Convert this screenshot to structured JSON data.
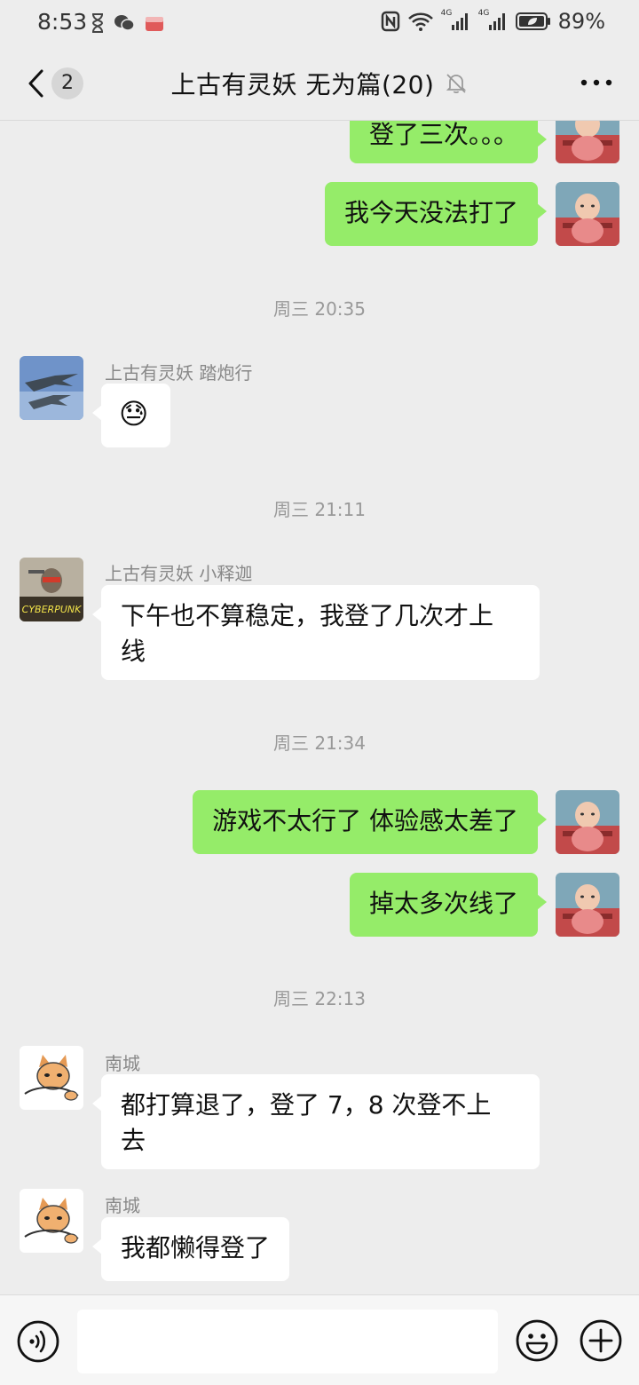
{
  "status_bar": {
    "time": "8:53",
    "battery": "89%",
    "network_1": "4G",
    "network_2": "4G"
  },
  "header": {
    "unread_count": "2",
    "title": "上古有灵妖 无为篇(20)"
  },
  "messages": [
    {
      "type": "me",
      "text": "登了三次。。。"
    },
    {
      "type": "me",
      "text": "我今天没法打了"
    },
    {
      "type": "time",
      "text": "周三 20:35"
    },
    {
      "type": "other",
      "sender": "上古有灵妖 踏炮行",
      "text": "😓"
    },
    {
      "type": "time",
      "text": "周三 21:11"
    },
    {
      "type": "other",
      "sender": "上古有灵妖 小释迦",
      "line1": "下午也不算稳定，我登了几次才上",
      "line2": "线"
    },
    {
      "type": "time",
      "text": "周三 21:34"
    },
    {
      "type": "me",
      "text": "游戏不太行了 体验感太差了"
    },
    {
      "type": "me",
      "text": "掉太多次线了"
    },
    {
      "type": "time",
      "text": "周三 22:13"
    },
    {
      "type": "other",
      "sender": "南城",
      "line1": "都打算退了，登了 7，8 次登不上",
      "line2": "去"
    },
    {
      "type": "other",
      "sender": "南城",
      "text": "我都懒得登了"
    }
  ],
  "avatar_art": {
    "cyberpunk_logo": "CYBERPUNK"
  },
  "input": {
    "value": "",
    "placeholder": ""
  },
  "colors": {
    "my_bubble": "#95ec69",
    "other_bubble": "#ffffff",
    "background": "#ededed"
  }
}
